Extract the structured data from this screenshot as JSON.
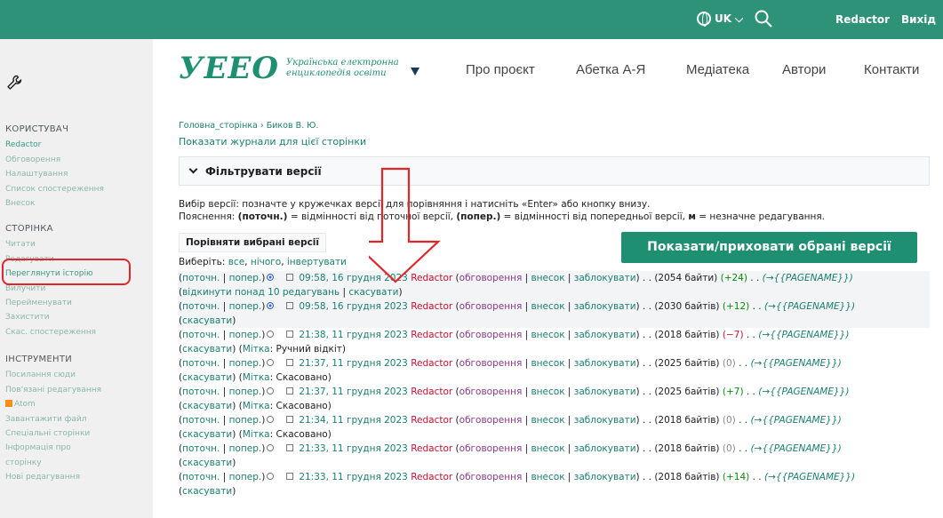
{
  "topbar": {
    "language": "UK",
    "user": "Redactor",
    "logout": "Вихід"
  },
  "logo": {
    "main": "УЕЕО",
    "subtitle": "Українська електронна енциклопедія освіти"
  },
  "nav": [
    "Про проєкт",
    "Абетка А-Я",
    "Медіатека",
    "Автори",
    "Контакти"
  ],
  "sidebar": {
    "user_head": "КОРИСТУВАЧ",
    "user_items": [
      "Redactor",
      "Обговорення",
      "Налаштування",
      "Список спостереження",
      "Внесок"
    ],
    "page_head": "СТОРІНКА",
    "page_items": [
      "Читати",
      "Редагувати",
      "Переглянути історію",
      "Вилучити",
      "Перейменувати",
      "Захистити",
      "Скас. спостереження"
    ],
    "tools_head": "ІНСТРУМЕНТИ",
    "tools_items": [
      "Посилання сюди",
      "Пов'язані редагування",
      "Atom",
      "Завантажити файл",
      "Спеціальні сторінки",
      "Інформація про",
      "сторінку",
      "Нові редагування"
    ]
  },
  "breadcrumb": "Головна_сторінка › Биков В. Ю.",
  "logs_link": "Показати журнали для цієї сторінки",
  "filter_label": "Фільтрувати версії",
  "explain1": "Вибір версії: позначте у кружечках версії для порівняння і натисніть «Enter» або кнопку внизу.",
  "explain2": {
    "p1": "Пояснення: ",
    "cur": "(поточн.)",
    "p2": " = відмінності від поточної версії, ",
    "prev": "(попер.)",
    "p3": " = відмінності від попередньої версії, ",
    "m": "м",
    "p4": " = незначне редагування."
  },
  "compare_button": "Порівняти вибрані версії",
  "showhide_button": "Показати/приховати обрані версії",
  "select": {
    "label": "Виберіть: ",
    "all": "все",
    "none": "нічого",
    "invert": "інвертувати"
  },
  "rows": [
    {
      "cur": "поточн.",
      "prev": "попер.",
      "date": "09:58, 16 грудня 2023",
      "user": "Redactor",
      "talk": "обговорення",
      "contrib": "внесок",
      "block": "заблокувати",
      "size": "(2054 байти)",
      "diff": "(+24)",
      "diffType": "pos",
      "summary": "(→{{PAGENAME}})",
      "line2a": "(",
      "rollback": "відкинути понад 10 редагувань",
      "sep": " | ",
      "undo": "скасувати",
      "line2b": ")",
      "tag": ""
    },
    {
      "cur": "поточн.",
      "prev": "попер.",
      "date": "09:58, 16 грудня 2023",
      "user": "Redactor",
      "talk": "обговорення",
      "contrib": "внесок",
      "block": "заблокувати",
      "size": "(2030 байтів)",
      "diff": "(+12)",
      "diffType": "pos",
      "summary": "(→{{PAGENAME}})",
      "undo": "скасувати",
      "tag": ""
    },
    {
      "cur": "поточн.",
      "prev": "попер.",
      "date": "21:38, 11 грудня 2023",
      "user": "Redactor",
      "talk": "обговорення",
      "contrib": "внесок",
      "block": "заблокувати",
      "size": "(2018 байтів)",
      "diff": "(−7)",
      "diffType": "neg",
      "summary": "(→{{PAGENAME}})",
      "undo": "скасувати",
      "tagLabel": "Мітка",
      "tag": "Ручний відкіт"
    },
    {
      "cur": "поточн.",
      "prev": "попер.",
      "date": "21:37, 11 грудня 2023",
      "user": "Redactor",
      "talk": "обговорення",
      "contrib": "внесок",
      "block": "заблокувати",
      "size": "(2025 байтів)",
      "diff": "(0)",
      "diffType": "zero",
      "summary": "(→{{PAGENAME}})",
      "undo": "скасувати",
      "tagLabel": "Мітка",
      "tag": "Скасовано"
    },
    {
      "cur": "поточн.",
      "prev": "попер.",
      "date": "21:37, 11 грудня 2023",
      "user": "Redactor",
      "talk": "обговорення",
      "contrib": "внесок",
      "block": "заблокувати",
      "size": "(2025 байтів)",
      "diff": "(+7)",
      "diffType": "pos",
      "summary": "(→{{PAGENAME}})",
      "undo": "скасувати",
      "tagLabel": "Мітка",
      "tag": "Скасовано"
    },
    {
      "cur": "поточн.",
      "prev": "попер.",
      "date": "21:34, 11 грудня 2023",
      "user": "Redactor",
      "talk": "обговорення",
      "contrib": "внесок",
      "block": "заблокувати",
      "size": "(2018 байтів)",
      "diff": "(0)",
      "diffType": "zero",
      "summary": "(→{{PAGENAME}})",
      "undo": "скасувати",
      "tagLabel": "Мітка",
      "tag": "Скасовано"
    },
    {
      "cur": "поточн.",
      "prev": "попер.",
      "date": "21:33, 11 грудня 2023",
      "user": "Redactor",
      "talk": "обговорення",
      "contrib": "внесок",
      "block": "заблокувати",
      "size": "(2018 байтів)",
      "diff": "(0)",
      "diffType": "zero",
      "summary": "(→{{PAGENAME}})",
      "undo": "скасувати",
      "tag": ""
    },
    {
      "cur": "поточн.",
      "prev": "попер.",
      "date": "21:33, 11 грудня 2023",
      "user": "Redactor",
      "talk": "обговорення",
      "contrib": "внесок",
      "block": "заблокувати",
      "size": "(2018 байтів)",
      "diff": "(+14)",
      "diffType": "pos",
      "summary": "(→{{PAGENAME}})",
      "undo": "скасувати",
      "tag": ""
    }
  ],
  "colors": {
    "brand": "#2e9278",
    "link": "#1a7f6e",
    "annotation": "#e0262b"
  }
}
